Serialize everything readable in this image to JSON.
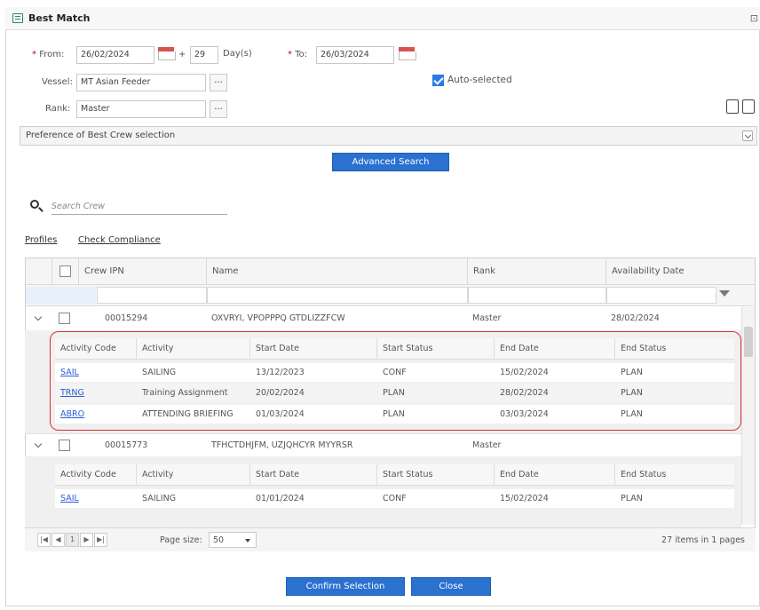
{
  "title": "Best Match",
  "title_right": "⊡",
  "form": {
    "from_label": "From:",
    "from_value": "26/02/2024",
    "plus": "+",
    "days_value": "29",
    "days_label": "Day(s)",
    "to_label": "To:",
    "to_value": "26/03/2024",
    "vessel_label": "Vessel:",
    "vessel_value": "MT Asian Feeder",
    "rank_label": "Rank:",
    "rank_value": "Master",
    "auto_selected_label": "Auto-selected",
    "lookup_label": "..."
  },
  "preference_label": "Preference of Best Crew selection",
  "advanced_search_label": "Advanced Search",
  "search_placeholder": "Search Crew",
  "links": {
    "profiles": "Profiles",
    "check_compliance": "Check Compliance"
  },
  "grid": {
    "columns": [
      "Crew IPN",
      "Name",
      "Rank",
      "Availability Date"
    ],
    "rows": [
      {
        "ipn": "00015294",
        "name": "OXVRYI, VPOPPPQ GTDLIZZFCW",
        "rank": "Master",
        "availability": "28/02/2024",
        "activities": [
          {
            "code": "SAIL",
            "activity": "SAILING",
            "start_date": "13/12/2023",
            "start_status": "CONF",
            "end_date": "15/02/2024",
            "end_status": "PLAN"
          },
          {
            "code": "TRNG",
            "activity": "Training Assignment",
            "start_date": "20/02/2024",
            "start_status": "PLAN",
            "end_date": "28/02/2024",
            "end_status": "PLAN"
          },
          {
            "code": "ABRO",
            "activity": "ATTENDING BRIEFING",
            "start_date": "01/03/2024",
            "start_status": "PLAN",
            "end_date": "03/03/2024",
            "end_status": "PLAN"
          }
        ]
      },
      {
        "ipn": "00015773",
        "name": "TFHCTDHJFM, UZJQHCYR MYYRSR",
        "rank": "Master",
        "availability": "",
        "activities": [
          {
            "code": "SAIL",
            "activity": "SAILING",
            "start_date": "01/01/2024",
            "start_status": "CONF",
            "end_date": "15/02/2024",
            "end_status": "PLAN"
          }
        ]
      }
    ],
    "sub_columns": [
      "Activity Code",
      "Activity",
      "Start Date",
      "Start Status",
      "End Date",
      "End Status"
    ]
  },
  "pager": {
    "first": "|◀",
    "prev": "◀",
    "page": "1",
    "next": "▶",
    "last": "▶|",
    "page_size_label": "Page size:",
    "page_size_value": "50",
    "summary": "27 items in 1 pages"
  },
  "buttons": {
    "confirm": "Confirm Selection",
    "close": "Close"
  },
  "colors": {
    "accent": "#2a71d0",
    "highlight": "#d9303a",
    "link": "#2a5ed6"
  }
}
